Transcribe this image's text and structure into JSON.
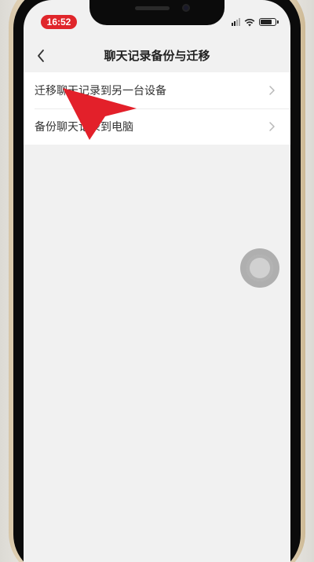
{
  "status_bar": {
    "time": "16:52",
    "battery_level": 0.8,
    "icons": [
      "signal-icon",
      "wifi-icon",
      "battery-icon"
    ]
  },
  "header": {
    "back_icon": "chevron-left-icon",
    "title": "聊天记录备份与迁移"
  },
  "menu": {
    "items": [
      {
        "label": "迁移聊天记录到另一台设备",
        "icon": "chevron-right-icon"
      },
      {
        "label": "备份聊天记录到电脑",
        "icon": "chevron-right-icon"
      }
    ]
  },
  "overlays": {
    "assistive_touch": "assistive-touch-icon",
    "annotation_arrow_color": "#e3202a"
  },
  "colors": {
    "time_pill": "#e0262b",
    "screen_background": "#f1f1f1",
    "list_background": "#ffffff"
  }
}
